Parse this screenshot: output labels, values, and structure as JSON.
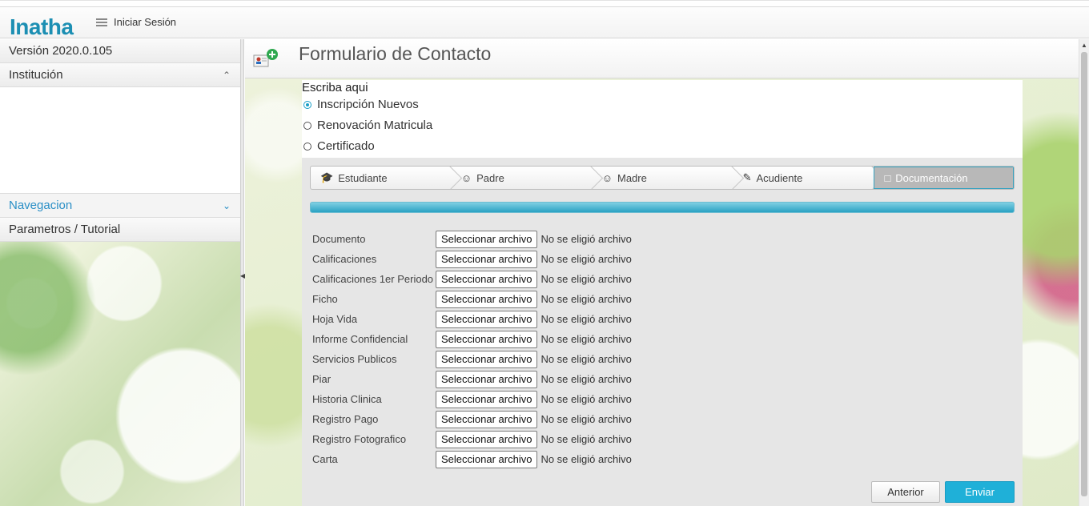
{
  "app": {
    "logo": "Inatha",
    "login_label": "Iniciar Sesión"
  },
  "sidebar": {
    "version": "Versión 2020.0.105",
    "institution": "Institución",
    "navigation": "Navegacion",
    "params": "Parametros / Tutorial"
  },
  "page": {
    "title": "Formulario de Contacto"
  },
  "form": {
    "heading": "Escriba aqui",
    "options": [
      {
        "label": "Inscripción Nuevos",
        "selected": true
      },
      {
        "label": "Renovación Matricula",
        "selected": false
      },
      {
        "label": "Certificado",
        "selected": false
      }
    ]
  },
  "wizard": {
    "steps": [
      {
        "label": "Estudiante",
        "icon": "graduation-cap-icon"
      },
      {
        "label": "Padre",
        "icon": "user-icon"
      },
      {
        "label": "Madre",
        "icon": "user-icon"
      },
      {
        "label": "Acudiente",
        "icon": "pencil-icon"
      },
      {
        "label": "Documentación",
        "icon": "document-icon",
        "active": true
      }
    ],
    "progress": 1.0
  },
  "files": {
    "button_label": "Seleccionar archivo",
    "status": "No se eligió archivo",
    "items": [
      "Documento",
      "Calificaciones",
      "Calificaciones 1er Periodo",
      "Ficho",
      "Hoja Vida",
      "Informe Confidencial",
      "Servicios Publicos",
      "Piar",
      "Historia Clinica",
      "Registro Pago",
      "Registro Fotografico",
      "Carta"
    ]
  },
  "actions": {
    "previous": "Anterior",
    "submit": "Enviar"
  },
  "colors": {
    "accent": "#1fb0d8",
    "logo": "#1c8fb3",
    "nav": "#2a8fc6"
  }
}
